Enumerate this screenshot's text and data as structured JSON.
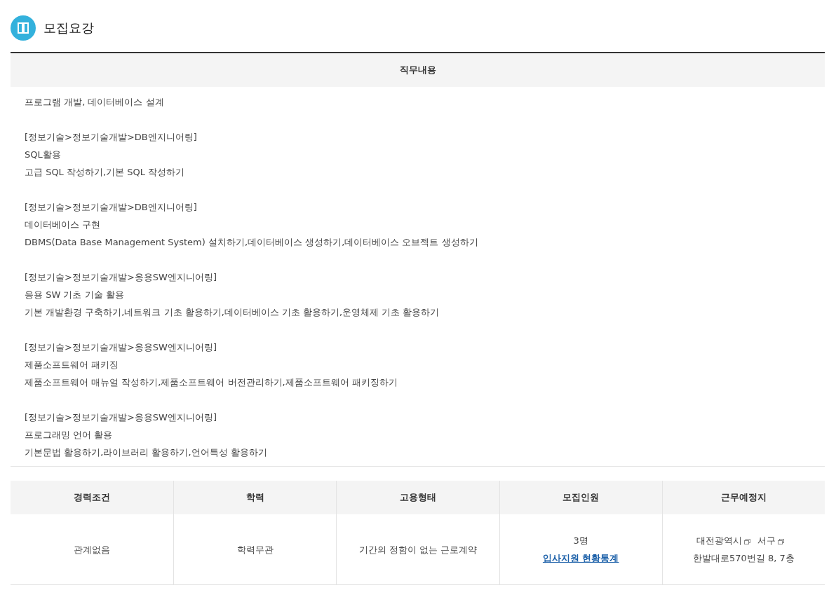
{
  "section": {
    "title": "모집요강"
  },
  "job": {
    "heading": "직무내용",
    "blocks": [
      [
        "프로그램 개발, 데이터베이스 설계"
      ],
      [
        "[정보기술>정보기술개발>DB엔지니어링]",
        "SQL활용",
        "고급 SQL 작성하기,기본 SQL 작성하기"
      ],
      [
        "[정보기술>정보기술개발>DB엔지니어링]",
        "데이터베이스 구현",
        "DBMS(Data Base Management System) 설치하기,데이터베이스 생성하기,데이터베이스 오브젝트 생성하기"
      ],
      [
        "[정보기술>정보기술개발>응용SW엔지니어링]",
        "응용 SW 기초 기술 활용",
        "기본 개발환경 구축하기,네트워크 기초 활용하기,데이터베이스 기초 활용하기,운영체제 기초 활용하기"
      ],
      [
        "[정보기술>정보기술개발>응용SW엔지니어링]",
        "제품소프트웨어 패키징",
        "제품소프트웨어 매뉴얼 작성하기,제품소프트웨어 버전관리하기,제품소프트웨어 패키징하기"
      ],
      [
        "[정보기술>정보기술개발>응용SW엔지니어링]",
        "프로그래밍 언어 활용",
        "기본문법 활용하기,라이브러리 활용하기,언어특성 활용하기"
      ]
    ]
  },
  "conditions": {
    "columns": [
      "경력조건",
      "학력",
      "고용형태",
      "모집인원",
      "근무예정지"
    ],
    "cells": [
      {
        "kind": "text",
        "text": "관계없음"
      },
      {
        "kind": "text",
        "text": "학력무관"
      },
      {
        "kind": "text",
        "text": "기간의 정함이 없는 근로계약"
      },
      {
        "kind": "count",
        "text": "3명",
        "link": "입사지원 현황통계"
      },
      {
        "kind": "address",
        "parts": [
          {
            "text": "대전광역시",
            "popup": true
          },
          {
            "text": "서구",
            "popup": true
          },
          {
            "text": "한발대로570번길 8, 7층",
            "popup": false
          }
        ]
      }
    ]
  }
}
